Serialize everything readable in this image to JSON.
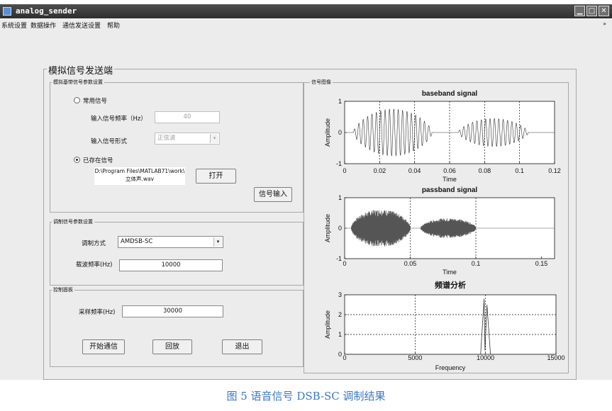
{
  "window": {
    "title": "analog_sender",
    "minimize_symbol": "▁",
    "maximize_symbol": "□",
    "close_symbol": "✕",
    "icon": "app-icon"
  },
  "menubar": {
    "items": [
      "系统设置",
      "数据操作",
      "通信发送设置",
      "帮助"
    ],
    "overflow_arrow": "»"
  },
  "main": {
    "title": "模拟信号发送端",
    "baseband_group": {
      "title": "模拟基带信号参数设置",
      "radio_common_label": "常用信号",
      "freq_label": "输入信号频率（Hz）",
      "freq_value": "40",
      "form_label": "输入信号形式",
      "form_value": "正弦波",
      "radio_existing_label": "已存在信号",
      "file_path_line1": "D:\\Program Files\\MATLAB71\\work\\",
      "file_path_line2": "立体声.wav",
      "open_button": "打开",
      "signal_input_button": "信号输入"
    },
    "modulation_group": {
      "title": "调制信号参数设置",
      "method_label": "调制方式",
      "method_value": "AMDSB-SC",
      "carrier_label": "载波频率(Hz)",
      "carrier_value": "10000"
    },
    "control_group": {
      "title": "控制面板",
      "sample_label": "采样频率(Hz)",
      "sample_value": "30000",
      "start_button": "开始通信",
      "playback_button": "回放",
      "exit_button": "退出"
    },
    "signal_group": {
      "title": "信号图像"
    }
  },
  "chart_data": [
    {
      "type": "line",
      "title": "baseband signal",
      "xlabel": "Time",
      "ylabel": "Amplitude",
      "xlim": [
        0,
        0.12
      ],
      "ylim": [
        -1,
        1
      ],
      "xticks": [
        "0",
        "0.02",
        "0.04",
        "0.06",
        "0.08",
        "0.1",
        "0.12"
      ],
      "yticks": [
        "-1",
        "0",
        "1"
      ],
      "grid": "x",
      "bursts": [
        {
          "start": 0.005,
          "end": 0.05,
          "peak": 0.75,
          "cycles": 18
        },
        {
          "start": 0.065,
          "end": 0.105,
          "peak": 0.45,
          "cycles": 16
        }
      ]
    },
    {
      "type": "line",
      "title": "passband signal",
      "xlabel": "Time",
      "ylabel": "Amplitude",
      "xlim": [
        0,
        0.16
      ],
      "ylim": [
        -1,
        1
      ],
      "xticks": [
        "0",
        "0.05",
        "0.1",
        "0.15"
      ],
      "yticks": [
        "-1",
        "0",
        "1"
      ],
      "grid": "x",
      "bursts": [
        {
          "start": 0.005,
          "end": 0.05,
          "peak": 0.62
        },
        {
          "start": 0.058,
          "end": 0.1,
          "peak": 0.33
        }
      ]
    },
    {
      "type": "line",
      "title": "频谱分析",
      "xlabel": "Frequency",
      "ylabel": "Amplitude",
      "xlim": [
        0,
        15000
      ],
      "ylim": [
        0,
        3
      ],
      "xticks": [
        "0",
        "5000",
        "10000",
        "15000"
      ],
      "yticks": [
        "0",
        "1",
        "2",
        "3"
      ],
      "grid": "xy",
      "peaks": [
        {
          "x": 9900,
          "y": 2.8
        },
        {
          "x": 10100,
          "y": 2.5
        }
      ]
    }
  ],
  "figure_caption": "图 5 语音信号 DSB-SC 调制结果"
}
